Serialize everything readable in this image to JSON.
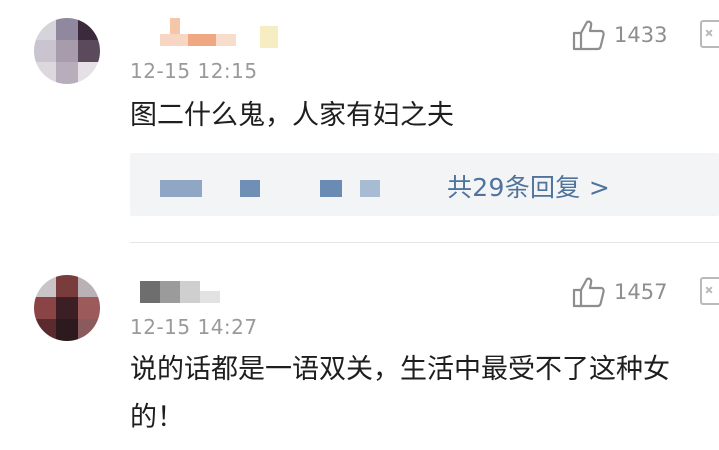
{
  "comments": [
    {
      "timestamp": "12-15 12:15",
      "like_count": "1433",
      "text": "图二什么鬼，人家有妇之夫",
      "replies": {
        "label": "共29条回复 >"
      }
    },
    {
      "timestamp": "12-15 14:27",
      "like_count": "1457",
      "text": "说的话都是一语双关，生活中最受不了这种女的！"
    }
  ],
  "icons": {
    "like": "thumbs-up-icon",
    "more": "collapse-icon"
  },
  "colors": {
    "timestamp": "#9a9a9a",
    "reply_link": "#50739c",
    "reply_bg": "#f3f4f6",
    "divider": "#e6e6e6"
  }
}
